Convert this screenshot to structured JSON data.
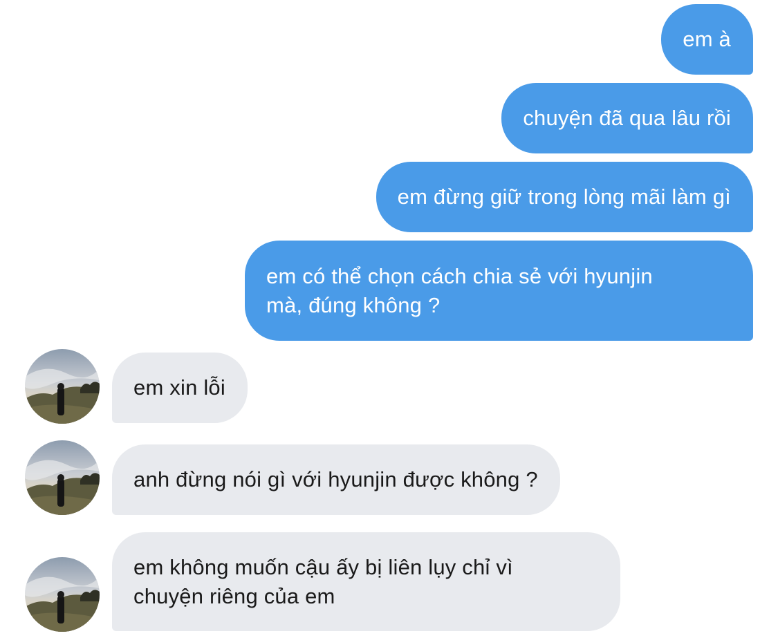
{
  "conversation": {
    "sent": [
      {
        "text": "em à"
      },
      {
        "text": "chuyện đã qua lâu rồi"
      },
      {
        "text": "em đừng giữ trong lòng mãi làm gì"
      },
      {
        "text": "em có thể chọn cách chia sẻ với hyunjin\nmà, đúng không ?"
      }
    ],
    "received": [
      {
        "text": "em xin lỗi",
        "avatar_icon": "profile-photo-avatar"
      },
      {
        "text": "anh đừng nói gì với hyunjin được không ?",
        "avatar_icon": "profile-photo-avatar"
      },
      {
        "text": "em không muốn cậu ấy bị liên lụy chỉ vì\nchuyện riêng của em",
        "avatar_icon": "profile-photo-avatar"
      }
    ]
  },
  "colors": {
    "sent_bubble": "#4a9be8",
    "received_bubble": "#e8eaee",
    "sent_text": "#ffffff",
    "received_text": "#1a1a1a"
  }
}
